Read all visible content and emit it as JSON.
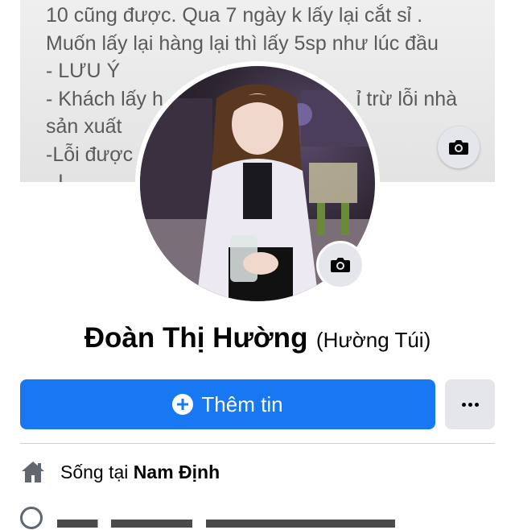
{
  "cover": {
    "lines": [
      "10 cũng được. Qua 7 ngày k lấy lại cắt sỉ .",
      "Muốn lấy lại hàng lại thì lấy 5sp như lúc đầu",
      "- LƯU Ý",
      "- Khách lấy h",
      "sản xuất",
      "-Lỗi được",
      "- L..."
    ],
    "partial_text_right": "ỉ trừ lỗi nhà",
    "camera_icon": "camera-icon"
  },
  "profile": {
    "name": "Đoàn Thị Hường",
    "nickname": "(Hường Túi)",
    "avatar_alt": "profile photo",
    "camera_icon": "camera-icon"
  },
  "actions": {
    "add_info_label": "Thêm tin",
    "add_icon": "plus-circle-icon",
    "more_icon": "more-horizontal-icon"
  },
  "about": {
    "lives_prefix": "Sống tại",
    "lives_city": "Nam Định",
    "home_icon": "home-icon"
  },
  "colors": {
    "primary": "#1877f2",
    "secondary_bg": "#e4e6eb",
    "text": "#050505",
    "icon_gray": "#606770"
  }
}
